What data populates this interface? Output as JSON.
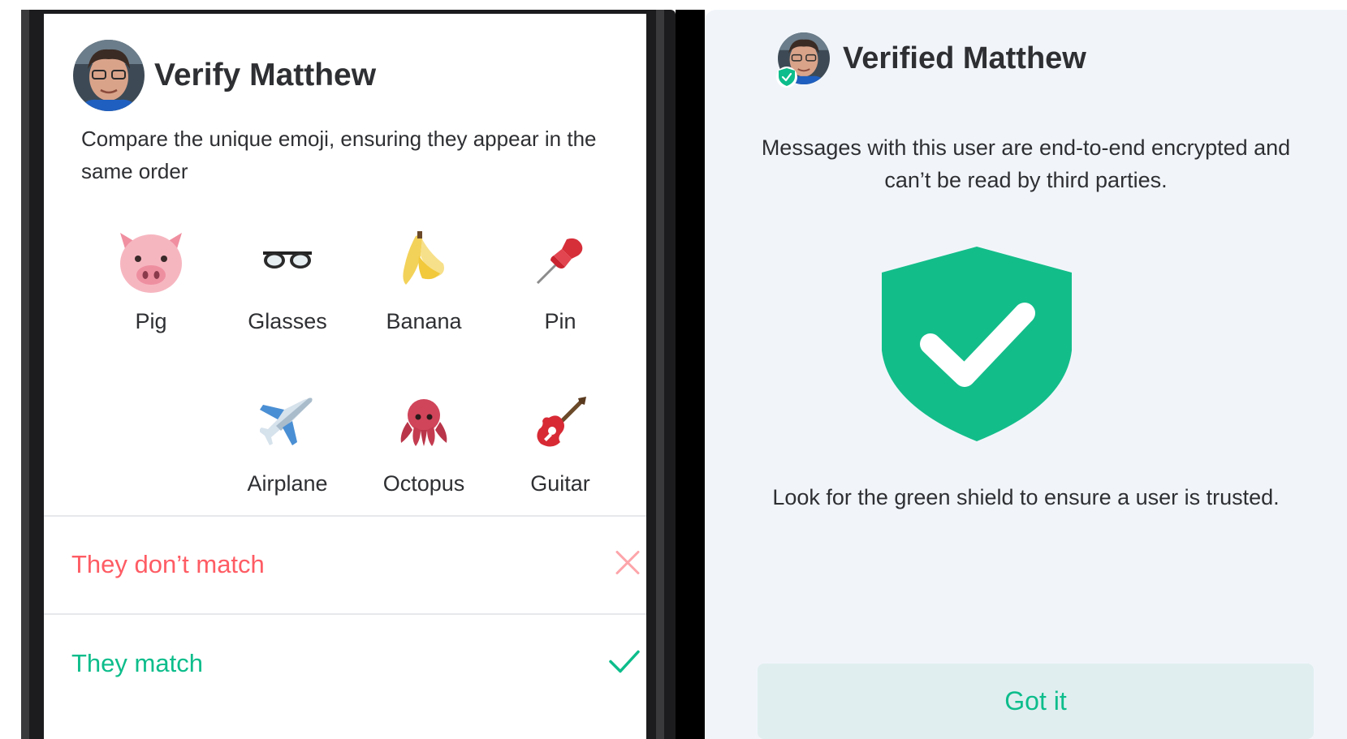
{
  "verify_panel": {
    "title": "Verify Matthew",
    "description": "Compare the unique emoji, ensuring they appear in the same order",
    "emoji": [
      {
        "icon": "pig-emoji",
        "label": "Pig"
      },
      {
        "icon": "glasses-emoji",
        "label": "Glasses"
      },
      {
        "icon": "banana-emoji",
        "label": "Banana"
      },
      {
        "icon": "pin-emoji",
        "label": "Pin"
      },
      {
        "icon": "airplane-emoji",
        "label": "Airplane"
      },
      {
        "icon": "octopus-emoji",
        "label": "Octopus"
      },
      {
        "icon": "guitar-emoji",
        "label": "Guitar"
      }
    ],
    "no_match_label": "They don’t match",
    "match_label": "They match"
  },
  "verified_panel": {
    "title": "Verified Matthew",
    "encryption_text": "Messages with this user are end-to-end encrypted and can’t be read by third parties.",
    "shield_hint": "Look for the green shield to ensure a user is trusted.",
    "got_it_label": "Got it"
  },
  "colors": {
    "accent_green": "#0dbd8b",
    "alert_red": "#fe5c64",
    "sheet_background": "#f1f5fa"
  }
}
